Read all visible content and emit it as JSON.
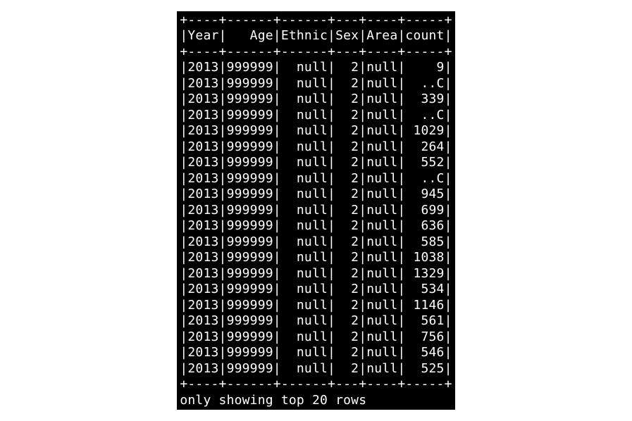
{
  "table": {
    "columns": [
      {
        "name": "Year",
        "width": 4,
        "align": "right"
      },
      {
        "name": "Age",
        "width": 6,
        "align": "right"
      },
      {
        "name": "Ethnic",
        "width": 6,
        "align": "right"
      },
      {
        "name": "Sex",
        "width": 3,
        "align": "right"
      },
      {
        "name": "Area",
        "width": 4,
        "align": "right"
      },
      {
        "name": "count",
        "width": 5,
        "align": "right"
      }
    ],
    "rows": [
      {
        "Year": "2013",
        "Age": "999999",
        "Ethnic": "null",
        "Sex": "2",
        "Area": "null",
        "count": "9"
      },
      {
        "Year": "2013",
        "Age": "999999",
        "Ethnic": "null",
        "Sex": "2",
        "Area": "null",
        "count": "..C"
      },
      {
        "Year": "2013",
        "Age": "999999",
        "Ethnic": "null",
        "Sex": "2",
        "Area": "null",
        "count": "339"
      },
      {
        "Year": "2013",
        "Age": "999999",
        "Ethnic": "null",
        "Sex": "2",
        "Area": "null",
        "count": "..C"
      },
      {
        "Year": "2013",
        "Age": "999999",
        "Ethnic": "null",
        "Sex": "2",
        "Area": "null",
        "count": "1029"
      },
      {
        "Year": "2013",
        "Age": "999999",
        "Ethnic": "null",
        "Sex": "2",
        "Area": "null",
        "count": "264"
      },
      {
        "Year": "2013",
        "Age": "999999",
        "Ethnic": "null",
        "Sex": "2",
        "Area": "null",
        "count": "552"
      },
      {
        "Year": "2013",
        "Age": "999999",
        "Ethnic": "null",
        "Sex": "2",
        "Area": "null",
        "count": "..C"
      },
      {
        "Year": "2013",
        "Age": "999999",
        "Ethnic": "null",
        "Sex": "2",
        "Area": "null",
        "count": "945"
      },
      {
        "Year": "2013",
        "Age": "999999",
        "Ethnic": "null",
        "Sex": "2",
        "Area": "null",
        "count": "699"
      },
      {
        "Year": "2013",
        "Age": "999999",
        "Ethnic": "null",
        "Sex": "2",
        "Area": "null",
        "count": "636"
      },
      {
        "Year": "2013",
        "Age": "999999",
        "Ethnic": "null",
        "Sex": "2",
        "Area": "null",
        "count": "585"
      },
      {
        "Year": "2013",
        "Age": "999999",
        "Ethnic": "null",
        "Sex": "2",
        "Area": "null",
        "count": "1038"
      },
      {
        "Year": "2013",
        "Age": "999999",
        "Ethnic": "null",
        "Sex": "2",
        "Area": "null",
        "count": "1329"
      },
      {
        "Year": "2013",
        "Age": "999999",
        "Ethnic": "null",
        "Sex": "2",
        "Area": "null",
        "count": "534"
      },
      {
        "Year": "2013",
        "Age": "999999",
        "Ethnic": "null",
        "Sex": "2",
        "Area": "null",
        "count": "1146"
      },
      {
        "Year": "2013",
        "Age": "999999",
        "Ethnic": "null",
        "Sex": "2",
        "Area": "null",
        "count": "561"
      },
      {
        "Year": "2013",
        "Age": "999999",
        "Ethnic": "null",
        "Sex": "2",
        "Area": "null",
        "count": "756"
      },
      {
        "Year": "2013",
        "Age": "999999",
        "Ethnic": "null",
        "Sex": "2",
        "Area": "null",
        "count": "546"
      },
      {
        "Year": "2013",
        "Age": "999999",
        "Ethnic": "null",
        "Sex": "2",
        "Area": "null",
        "count": "525"
      }
    ],
    "footer": "only showing top 20 rows"
  }
}
